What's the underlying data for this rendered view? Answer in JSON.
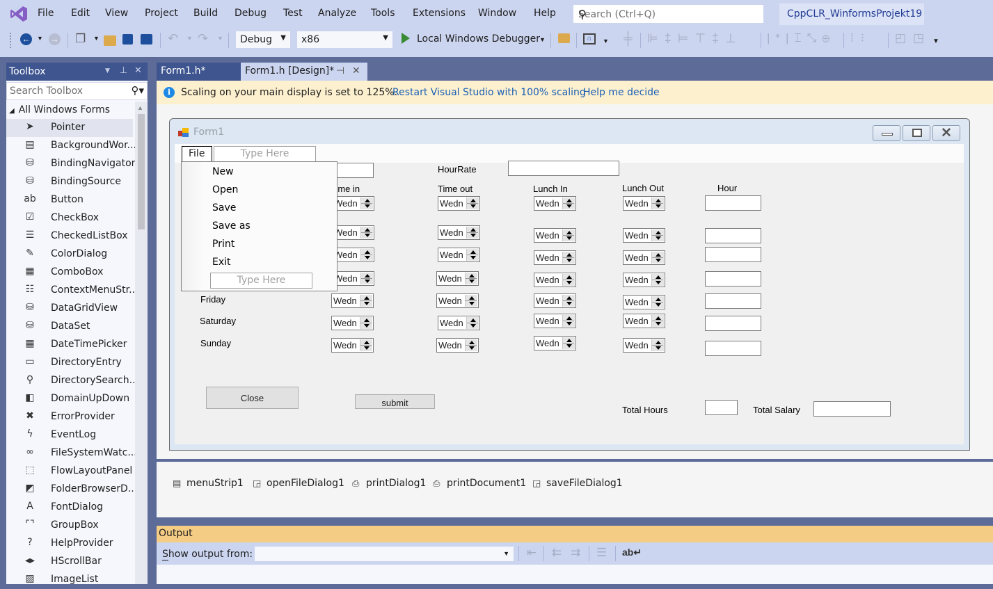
{
  "app": {
    "menu": [
      "File",
      "Edit",
      "View",
      "Project",
      "Build",
      "Debug",
      "Test",
      "Analyze",
      "Tools",
      "Extensions",
      "Window",
      "Help"
    ],
    "search_placeholder": "Search (Ctrl+Q)",
    "project_name": "CppCLR_WinformsProjekt19",
    "accent": "#68217a"
  },
  "toolbar": {
    "config": "Debug",
    "platform": "x86",
    "run_label": "Local Windows Debugger",
    "icons": [
      "navigate-back-icon",
      "navigate-forward-icon",
      "new-project-icon",
      "open-file-icon",
      "save-icon",
      "save-all-icon",
      "undo-icon",
      "redo-icon",
      "start-debug-icon",
      "find-in-files-icon",
      "designer-home-icon",
      "layout-icons"
    ]
  },
  "toolbox": {
    "title": "Toolbox",
    "search_placeholder": "Search Toolbox",
    "group": "All Windows Forms",
    "items": [
      {
        "label": "Pointer",
        "icon": "pointer-icon",
        "glyph": "➤"
      },
      {
        "label": "BackgroundWor...",
        "icon": "background-worker-icon",
        "glyph": "▤"
      },
      {
        "label": "BindingNavigator",
        "icon": "binding-navigator-icon",
        "glyph": "⛁"
      },
      {
        "label": "BindingSource",
        "icon": "binding-source-icon",
        "glyph": "⛁"
      },
      {
        "label": "Button",
        "icon": "button-icon",
        "glyph": "ab"
      },
      {
        "label": "CheckBox",
        "icon": "checkbox-icon",
        "glyph": "☑"
      },
      {
        "label": "CheckedListBox",
        "icon": "checked-list-box-icon",
        "glyph": "☰"
      },
      {
        "label": "ColorDialog",
        "icon": "color-dialog-icon",
        "glyph": "✎"
      },
      {
        "label": "ComboBox",
        "icon": "combobox-icon",
        "glyph": "▦"
      },
      {
        "label": "ContextMenuStr...",
        "icon": "context-menu-icon",
        "glyph": "☷"
      },
      {
        "label": "DataGridView",
        "icon": "datagridview-icon",
        "glyph": "⛁"
      },
      {
        "label": "DataSet",
        "icon": "dataset-icon",
        "glyph": "⛁"
      },
      {
        "label": "DateTimePicker",
        "icon": "datetimepicker-icon",
        "glyph": "▦"
      },
      {
        "label": "DirectoryEntry",
        "icon": "directory-entry-icon",
        "glyph": "▭"
      },
      {
        "label": "DirectorySearch...",
        "icon": "directory-searcher-icon",
        "glyph": "⚲"
      },
      {
        "label": "DomainUpDown",
        "icon": "domain-updown-icon",
        "glyph": "◧"
      },
      {
        "label": "ErrorProvider",
        "icon": "error-provider-icon",
        "glyph": "✖"
      },
      {
        "label": "EventLog",
        "icon": "eventlog-icon",
        "glyph": "ϟ"
      },
      {
        "label": "FileSystemWatc...",
        "icon": "filesystemwatcher-icon",
        "glyph": "∞"
      },
      {
        "label": "FlowLayoutPanel",
        "icon": "flowlayoutpanel-icon",
        "glyph": "⬚"
      },
      {
        "label": "FolderBrowserD...",
        "icon": "folder-browser-icon",
        "glyph": "◩"
      },
      {
        "label": "FontDialog",
        "icon": "font-dialog-icon",
        "glyph": "A"
      },
      {
        "label": "GroupBox",
        "icon": "groupbox-icon",
        "glyph": "⌜⌝"
      },
      {
        "label": "HelpProvider",
        "icon": "help-provider-icon",
        "glyph": "?"
      },
      {
        "label": "HScrollBar",
        "icon": "hscrollbar-icon",
        "glyph": "◂▸"
      },
      {
        "label": "ImageList",
        "icon": "imagelist-icon",
        "glyph": "▨"
      }
    ]
  },
  "tabs": [
    {
      "label": "Form1.h*",
      "active": false
    },
    {
      "label": "Form1.h [Design]*",
      "active": true
    }
  ],
  "infobar": {
    "message": "Scaling on your main display is set to 125%.",
    "link1": "Restart Visual Studio with 100% scaling",
    "link2": "Help me decide"
  },
  "form": {
    "title": "Form1",
    "menu": {
      "file": "File",
      "type_here": "Type Here",
      "items": [
        "New",
        "Open",
        "Save",
        "Save as",
        "Print",
        "Exit"
      ]
    },
    "labels": {
      "hour_rate": "HourRate",
      "time_in": "Time in",
      "time_out": "Time out",
      "lunch_in": "Lunch In",
      "lunch_out": "Lunch Out",
      "hour": "Hour",
      "total_hours": "Total Hours",
      "total_salary": "Total Salary"
    },
    "days": [
      "Friday",
      "Saturday",
      "Sunday"
    ],
    "spinner_value": "Wedn",
    "buttons": {
      "close": "Close",
      "submit": "submit"
    }
  },
  "tray": [
    {
      "label": "menuStrip1",
      "icon": "menustrip-icon",
      "glyph": "▤"
    },
    {
      "label": "openFileDialog1",
      "icon": "open-file-dialog-icon",
      "glyph": "◲"
    },
    {
      "label": "printDialog1",
      "icon": "print-dialog-icon",
      "glyph": "⎙"
    },
    {
      "label": "printDocument1",
      "icon": "print-document-icon",
      "glyph": "⎙"
    },
    {
      "label": "saveFileDialog1",
      "icon": "save-file-dialog-icon",
      "glyph": "◲"
    }
  ],
  "output": {
    "title": "Output",
    "show_from": "Show output from:",
    "source_value": ""
  }
}
